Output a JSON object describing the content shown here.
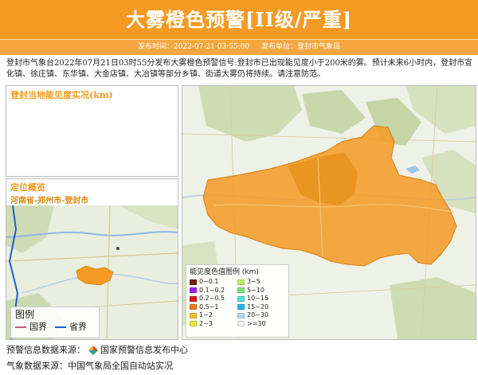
{
  "header": {
    "title": "大雾橙色预警[II级/严重]",
    "publish_time_label": "发布时间：2022-07-21 03:55:00",
    "publish_unit_label": "发布单位：登封市气象局"
  },
  "description": "登封市气象台2022年07月21日03时55分发布大雾橙色预警信号:登封市已出现能见度小于200米的雾。预计未来6小时内，登封市宣化镇、徐庄镇、东华镇、大金店镇、大冶镇等部分乡镇、街道大雾仍将持续。请注意防范。",
  "visibility_panel": {
    "title": "登封当地能见度实况(km)"
  },
  "location_panel": {
    "title": "定位概览",
    "path": "河南省-郑州市-登封市",
    "legend_title": "图例",
    "legend_items": [
      {
        "label": "国界",
        "color": "#c0607a"
      },
      {
        "label": "省界",
        "color": "#1e5fd0"
      }
    ]
  },
  "map_panel": {
    "fill_color": "#f59a23",
    "legend_title": "能见度色值图例 (km)",
    "legend_items": [
      {
        "label": "0~0.1",
        "color": "#7a1a0a"
      },
      {
        "label": "3~5",
        "color": "#b8f060"
      },
      {
        "label": "0.1~0.2",
        "color": "#a020f0"
      },
      {
        "label": "5~10",
        "color": "#7ee27e"
      },
      {
        "label": "0.2~0.5",
        "color": "#e01a1a"
      },
      {
        "label": "10~15",
        "color": "#4fe0d0"
      },
      {
        "label": "0.5~1",
        "color": "#f07a1a"
      },
      {
        "label": "15~20",
        "color": "#2ab0f0"
      },
      {
        "label": "1~2",
        "color": "#f0c020"
      },
      {
        "label": "20~30",
        "color": "#b0d8f0"
      },
      {
        "label": "2~3",
        "color": "#e8e830"
      },
      {
        "label": ">=30",
        "color": "#f0f0f0"
      }
    ]
  },
  "footer": {
    "warning_source_label": "预警信息数据来源：",
    "warning_source_name": "国家预警信息发布中心",
    "weather_source_label": "气象数据来源：中国气象局全国自动站实况"
  }
}
